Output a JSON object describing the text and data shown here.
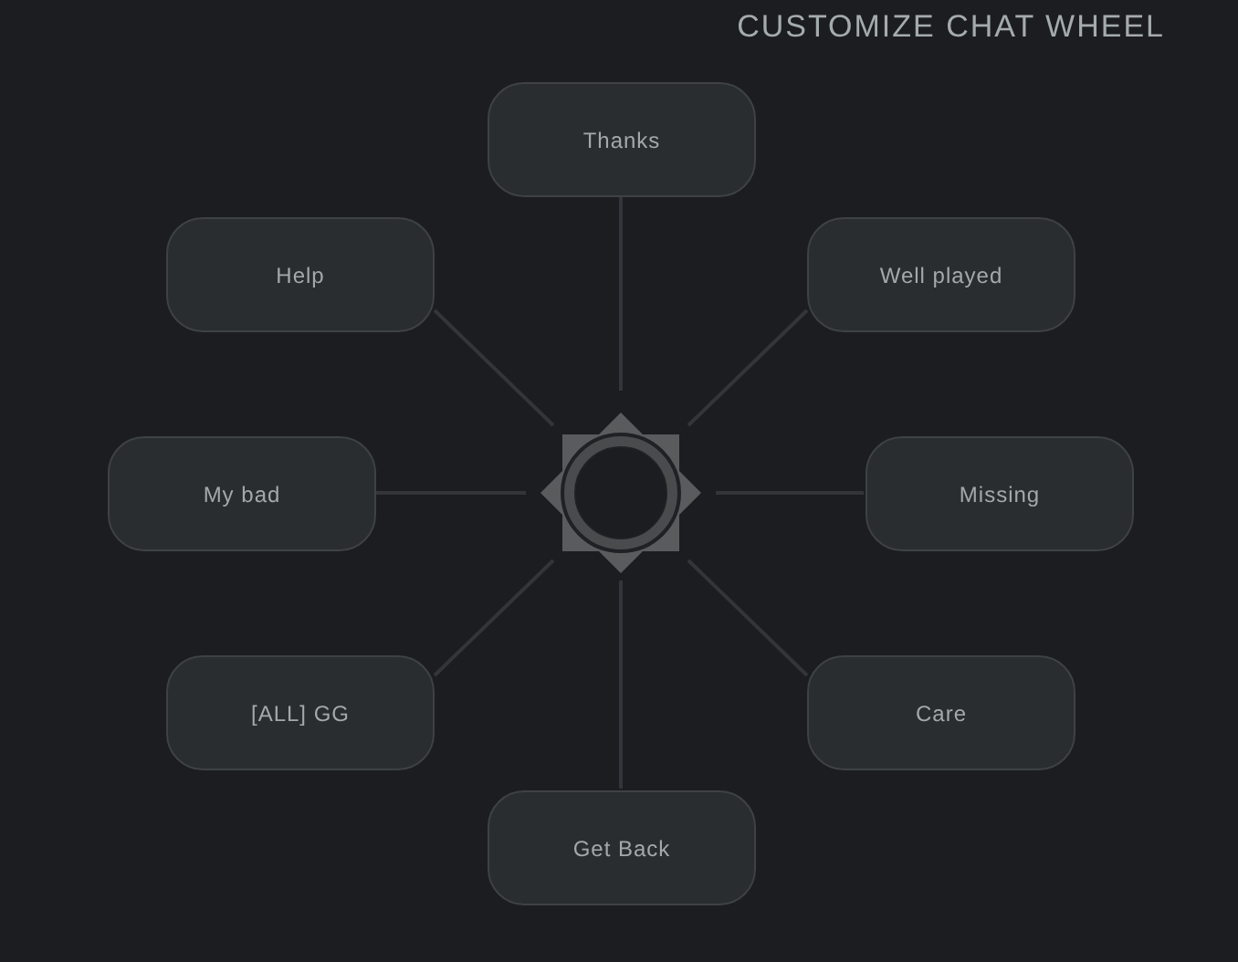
{
  "title": "CUSTOMIZE CHAT WHEEL",
  "phrases": [
    {
      "label": "Thanks"
    },
    {
      "label": "Well played"
    },
    {
      "label": "Missing"
    },
    {
      "label": "Care"
    },
    {
      "label": "Get Back"
    },
    {
      "label": "[ALL] GG"
    },
    {
      "label": "My bad"
    },
    {
      "label": "Help"
    }
  ]
}
